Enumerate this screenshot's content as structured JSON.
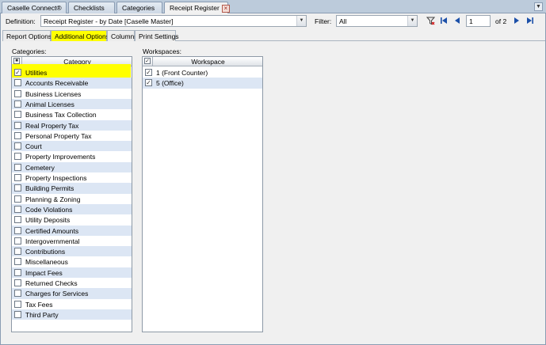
{
  "tabs": [
    {
      "label": "Caselle Connect®"
    },
    {
      "label": "Checklists"
    },
    {
      "label": "Categories"
    },
    {
      "label": "Receipt Register",
      "close": "×"
    }
  ],
  "toolbar": {
    "definition_label": "Definition:",
    "definition_value": "Receipt Register - by Date [Caselle Master]",
    "filter_label": "Filter:",
    "filter_value": "All",
    "page_value": "1",
    "page_total": "of 2"
  },
  "subtabs": [
    {
      "label": "Report Options"
    },
    {
      "label": "Additional Options",
      "active": true
    },
    {
      "label": "Columns"
    },
    {
      "label": "Print Settings"
    }
  ],
  "categories": {
    "label": "Categories:",
    "header": "Category",
    "items": [
      {
        "label": "Utilities",
        "checked": true
      },
      {
        "label": "Accounts Receivable",
        "checked": false
      },
      {
        "label": "Business Licenses",
        "checked": false
      },
      {
        "label": "Animal Licenses",
        "checked": false
      },
      {
        "label": "Business Tax Collection",
        "checked": false
      },
      {
        "label": "Real Property Tax",
        "checked": false
      },
      {
        "label": "Personal Property Tax",
        "checked": false
      },
      {
        "label": "Court",
        "checked": false
      },
      {
        "label": "Property Improvements",
        "checked": false
      },
      {
        "label": "Cemetery",
        "checked": false
      },
      {
        "label": "Property Inspections",
        "checked": false
      },
      {
        "label": "Building Permits",
        "checked": false
      },
      {
        "label": "Planning & Zoning",
        "checked": false
      },
      {
        "label": "Code Violations",
        "checked": false
      },
      {
        "label": "Utility Deposits",
        "checked": false
      },
      {
        "label": "Certified Amounts",
        "checked": false
      },
      {
        "label": "Intergovernmental",
        "checked": false
      },
      {
        "label": "Contributions",
        "checked": false
      },
      {
        "label": "Miscellaneous",
        "checked": false
      },
      {
        "label": "Impact Fees",
        "checked": false
      },
      {
        "label": "Returned Checks",
        "checked": false
      },
      {
        "label": "Charges for Services",
        "checked": false
      },
      {
        "label": "Tax Fees",
        "checked": false
      },
      {
        "label": "Third Party",
        "checked": false
      }
    ]
  },
  "workspaces": {
    "label": "Workspaces:",
    "header": "Workspace",
    "items": [
      {
        "label": "1 (Front Counter)",
        "checked": true
      },
      {
        "label": "5 (Office)",
        "checked": true
      }
    ]
  },
  "colors": {
    "highlight": "#ffff00",
    "row_alt": "#dce6f4"
  }
}
